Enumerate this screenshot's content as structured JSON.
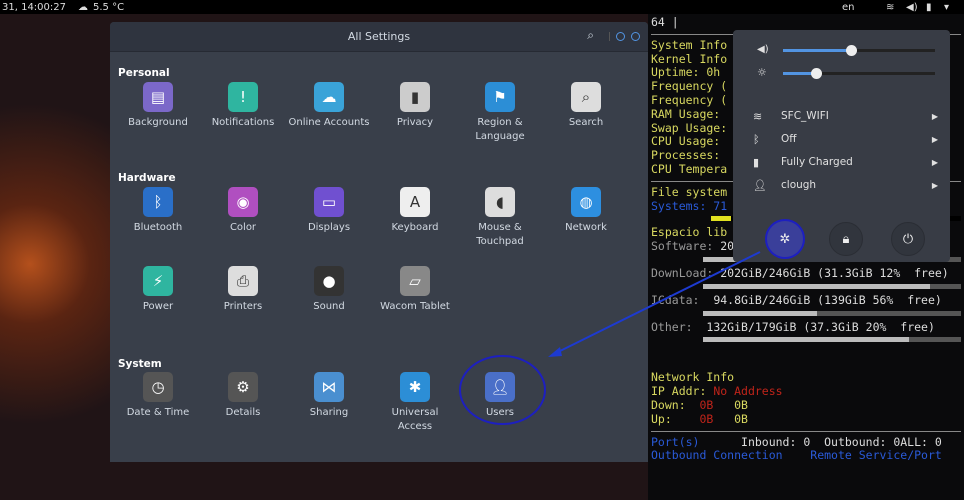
{
  "topbar": {
    "datetime": "31, 14:00:27",
    "weather": "5.5 °C",
    "lang": "en",
    "weather_icon": "cloud-sun-icon"
  },
  "settings": {
    "title": "All Settings",
    "sections": [
      {
        "label": "Personal",
        "items": [
          "Background",
          "Notifications",
          "Online Accounts",
          "Privacy",
          "Region & Language",
          "Search"
        ]
      },
      {
        "label": "Hardware",
        "items": [
          "Bluetooth",
          "Color",
          "Displays",
          "Keyboard",
          "Mouse & Touchpad",
          "Network",
          "Power",
          "Printers",
          "Sound",
          "Wacom Tablet"
        ]
      },
      {
        "label": "System",
        "items": [
          "Date & Time",
          "Details",
          "Sharing",
          "Universal Access",
          "Users"
        ]
      }
    ]
  },
  "terminal": {
    "top": "64 |",
    "lines": [
      "System Info",
      "Kernel Info",
      "Uptime: 0h",
      "Frequency (",
      "Frequency (",
      "RAM Usage:",
      "Swap Usage:",
      "CPU Usage:",
      "Processes:",
      "",
      "CPU Tempera"
    ],
    "fs_title": "File system",
    "fs_systems": "Systems: 71",
    "espacio": "Espacio lib",
    "disks": [
      {
        "label": "Software:",
        "value": "206GiB/246GiB (33.5GiB 13%  free)",
        "used": 0.87
      },
      {
        "label": "DownLoad:",
        "value": "202GiB/246GiB (31.3GiB 12%  free)",
        "used": 0.88
      },
      {
        "label": "ICdata:",
        "value": " 94.8GiB/246GiB (139GiB 56%  free)",
        "used": 0.44
      },
      {
        "label": "Other:",
        "value": " 132GiB/179GiB (37.3GiB 20%  free)",
        "used": 0.8
      }
    ],
    "net_title": "Network Info",
    "ip_label": "IP Addr:",
    "ip_value": "No Address",
    "down_label": "Down:",
    "down_a": "0B",
    "down_b": "0B",
    "up_label": "Up:",
    "up_a": "0B",
    "up_b": "0B",
    "ports": "Port(s)",
    "inbound": "Inbound: 0  Outbound: 0ALL: 0",
    "outbound_conn": "Outbound Connection",
    "remote": "Remote Service/Port"
  },
  "popover": {
    "volume": 0.45,
    "brightness": 0.22,
    "rows": [
      {
        "icon": "wifi-icon",
        "label": "SFC_WIFI"
      },
      {
        "icon": "bluetooth-icon",
        "label": "Off"
      },
      {
        "icon": "battery-icon",
        "label": "Fully Charged"
      },
      {
        "icon": "user-icon",
        "label": "clough"
      }
    ],
    "buttons": [
      "settings-icon",
      "lock-icon",
      "power-icon"
    ]
  },
  "colors": {
    "accent": "#5294e2",
    "annotation": "#1d1fc0"
  }
}
